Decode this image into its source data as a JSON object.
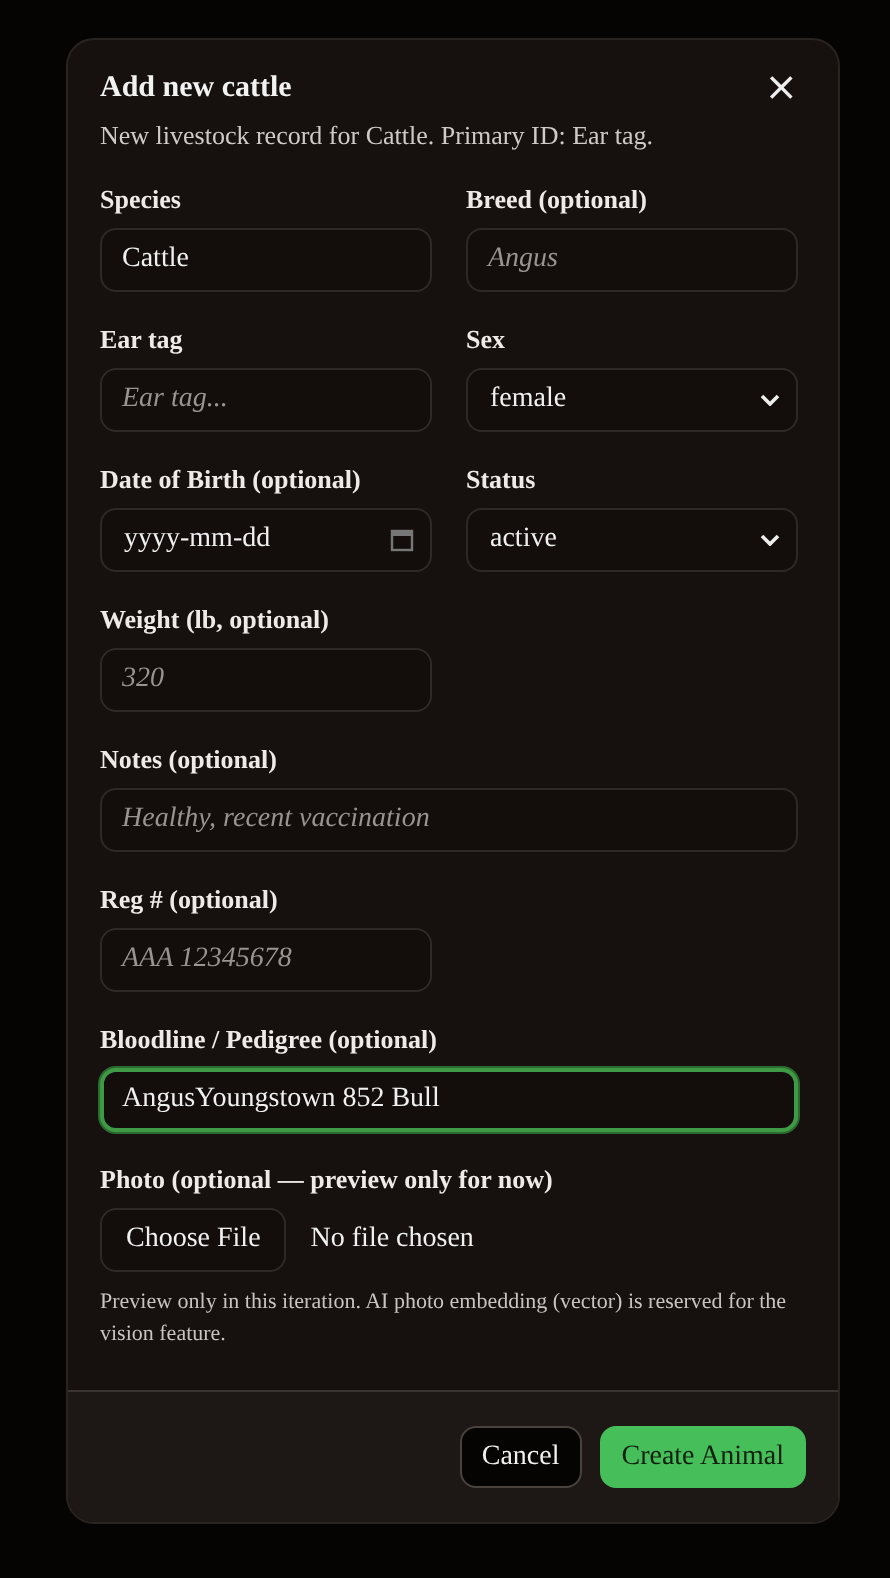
{
  "dialog": {
    "title": "Add new cattle",
    "close": "×",
    "subtitle": "New livestock record for Cattle. Primary ID: Ear tag."
  },
  "rows": [
    [
      {
        "kind": "text",
        "label": "Species",
        "value": "Cattle"
      },
      {
        "kind": "text",
        "label": "Breed (optional)",
        "placeholder": "Angus"
      }
    ],
    [
      {
        "kind": "text",
        "label": "Ear tag",
        "placeholder": "Ear tag..."
      },
      {
        "kind": "select",
        "label": "Sex",
        "value": "female"
      }
    ],
    [
      {
        "kind": "date",
        "label": "Date of Birth (optional)",
        "value": "yyyy-mm-dd"
      },
      {
        "kind": "select",
        "label": "Status",
        "value": "active"
      }
    ],
    [
      {
        "kind": "text",
        "label": "Weight (lb, optional)",
        "placeholder": "320"
      }
    ],
    [
      {
        "kind": "wide",
        "label": "Notes (optional)",
        "placeholder": "Healthy, recent vaccination"
      }
    ],
    [
      {
        "kind": "text",
        "label": "Reg # (optional)",
        "placeholder": "AAA 12345678"
      }
    ],
    [
      {
        "kind": "wide",
        "label": "Bloodline / Pedigree (optional)",
        "value": "AngusYoungstown 852 Bull",
        "focused": true
      }
    ],
    [
      {
        "kind": "file",
        "label": "Photo (optional — preview only for now)",
        "button": "Choose File",
        "status": "No file chosen",
        "note": "Preview only in this iteration. AI photo embedding (vector) is reserved for the vision feature."
      }
    ]
  ],
  "buttons": [
    {
      "label": "Cancel",
      "kind": "secondary"
    },
    {
      "label": "Create Animal",
      "kind": "primary"
    }
  ]
}
